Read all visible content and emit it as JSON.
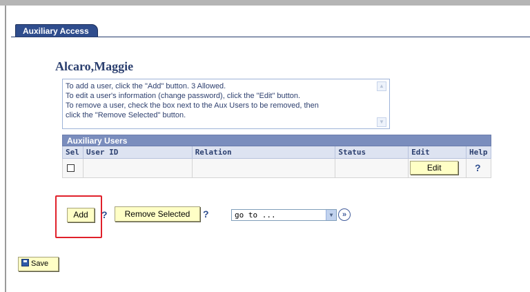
{
  "tab": {
    "label": "Auxiliary Access"
  },
  "person": {
    "name": "Alcaro,Maggie"
  },
  "instructions": {
    "lines": [
      "To add a user, click the \"Add\" button.  3 Allowed.",
      "To edit a user's information (change password), click the \"Edit\" button.",
      "To remove a user, check the box next to the Aux Users to be removed, then",
      "click the \"Remove Selected\" button."
    ]
  },
  "grid": {
    "title": "Auxiliary Users",
    "columns": [
      "Sel",
      "User ID",
      "Relation",
      "Status",
      "Edit",
      "Help"
    ],
    "rows": [
      {
        "selected": false,
        "user_id": "",
        "relation": "",
        "status": "",
        "edit_label": "Edit",
        "help": "?"
      }
    ]
  },
  "actions": {
    "add_label": "Add",
    "add_help": "?",
    "remove_label": "Remove Selected",
    "remove_help": "?",
    "goto_value": "go to ...",
    "go_icon": "double-chevron-right-icon"
  },
  "footer": {
    "save_label": "Save",
    "save_icon": "floppy-disk-icon"
  },
  "colors": {
    "tab_bg": "#2f4d8d",
    "grid_title_bg": "#7a8dbd",
    "button_bg": "#ffffc6",
    "highlight": "#e0202a"
  }
}
